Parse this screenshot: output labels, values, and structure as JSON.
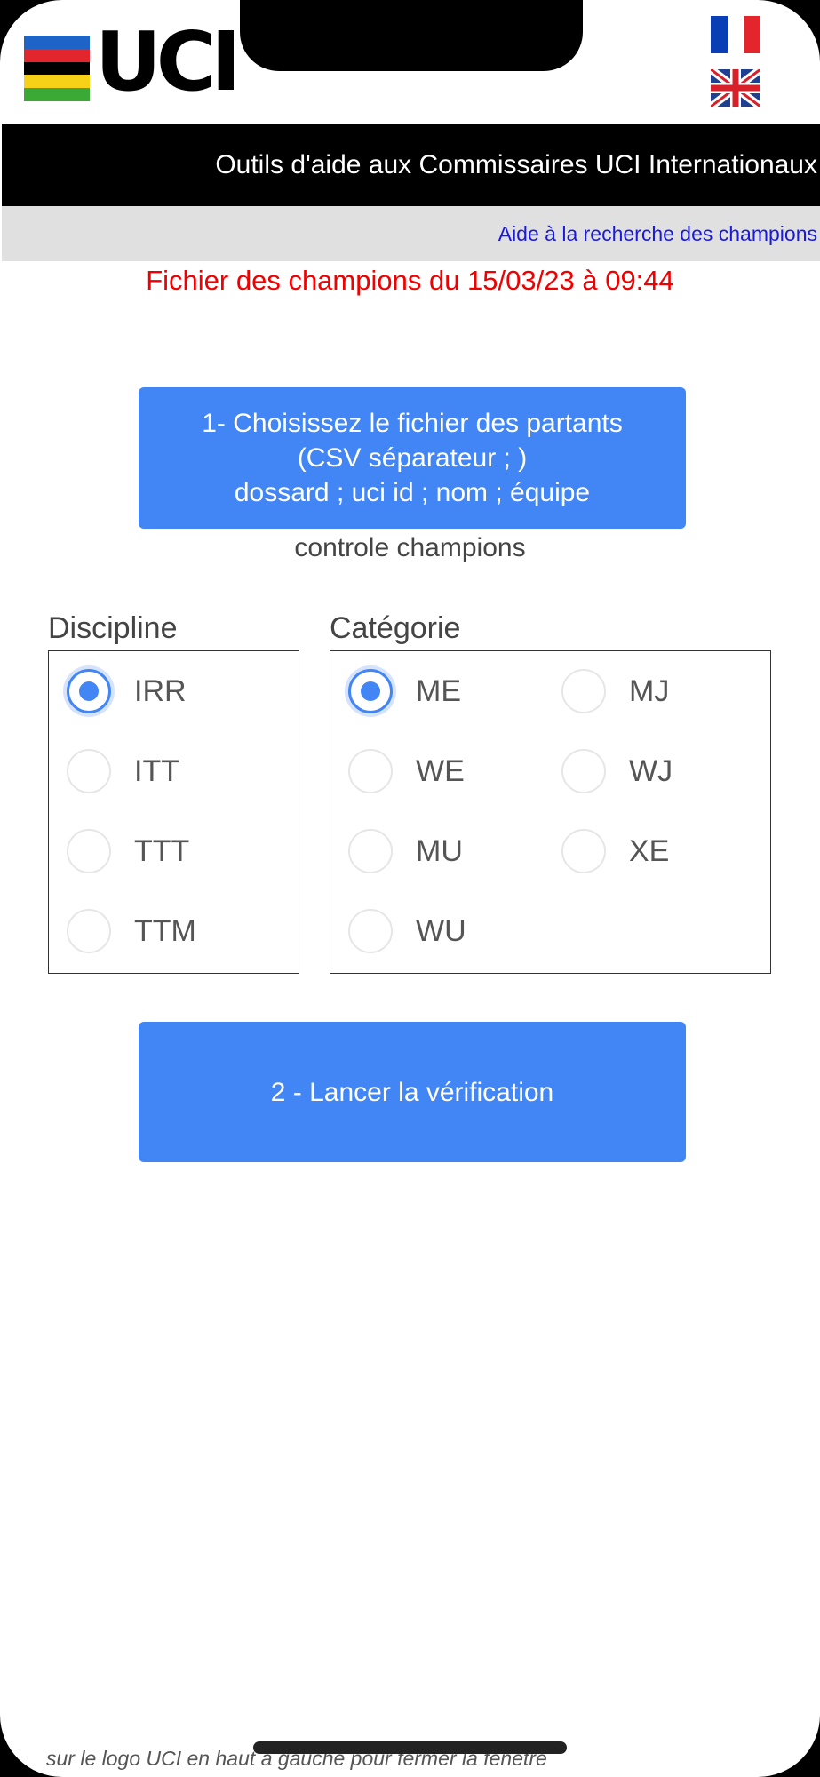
{
  "header": {
    "logo_text": "UCI",
    "title": "Outils d'aide aux Commissaires UCI Internationaux",
    "help_link": "Aide à la recherche des champions",
    "flags": [
      "flag-france-icon",
      "flag-uk-icon"
    ]
  },
  "main": {
    "champions_file_date": "Fichier des champions du 15/03/23 à 09:44",
    "file_button": {
      "line1": "1- Choisissez le fichier des partants",
      "line2": "(CSV séparateur ; )",
      "line3": "dossard ; uci id ; nom ; équipe"
    },
    "controle_label": "controle champions",
    "discipline": {
      "title": "Discipline",
      "options": [
        "IRR",
        "ITT",
        "TTT",
        "TTM"
      ],
      "selected": "IRR"
    },
    "categorie": {
      "title": "Catégorie",
      "options": [
        "ME",
        "MJ",
        "WE",
        "WJ",
        "MU",
        "XE",
        "WU"
      ],
      "selected": "ME"
    },
    "verify_button": "2 - Lancer la vérification"
  },
  "footer": {
    "hint": "sur le logo UCI en haut à gauche pour fermer la fenêtre"
  },
  "colors": {
    "accent": "#4285f4",
    "date_text": "#f00000",
    "link": "#1a1adb",
    "logo_stripes": [
      "#1e63c6",
      "#e3262b",
      "#000000",
      "#f7d117",
      "#3aaa35"
    ]
  }
}
